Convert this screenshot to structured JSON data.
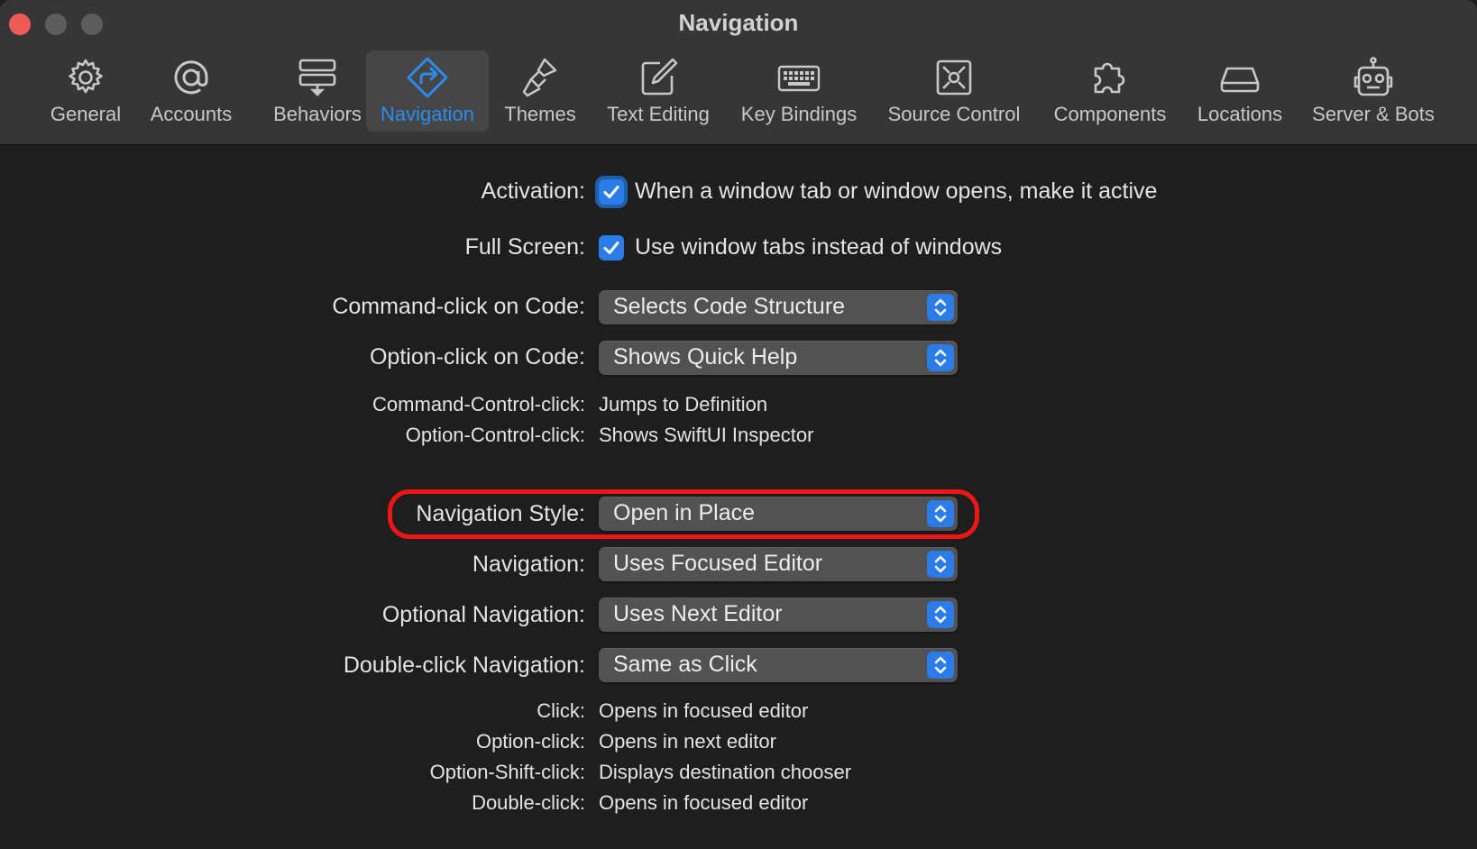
{
  "window": {
    "title": "Navigation"
  },
  "tabs": [
    {
      "label": "General",
      "icon": "gear-icon"
    },
    {
      "label": "Accounts",
      "icon": "at-sign-icon"
    },
    {
      "label": "Behaviors",
      "icon": "behaviors-icon"
    },
    {
      "label": "Navigation",
      "icon": "navigation-icon",
      "selected": true
    },
    {
      "label": "Themes",
      "icon": "brush-icon"
    },
    {
      "label": "Text Editing",
      "icon": "pencil-square-icon"
    },
    {
      "label": "Key Bindings",
      "icon": "keyboard-icon"
    },
    {
      "label": "Source Control",
      "icon": "source-control-icon"
    },
    {
      "label": "Components",
      "icon": "puzzle-icon"
    },
    {
      "label": "Locations",
      "icon": "drive-icon"
    },
    {
      "label": "Server & Bots",
      "icon": "robot-icon"
    }
  ],
  "activation": {
    "label": "Activation:",
    "checkbox_label": "When a window tab or window opens, make it active",
    "checked": true
  },
  "full_screen": {
    "label": "Full Screen:",
    "checkbox_label": "Use window tabs instead of windows",
    "checked": true
  },
  "command_click": {
    "label": "Command-click on Code:",
    "value": "Selects Code Structure"
  },
  "option_click": {
    "label": "Option-click on Code:",
    "value": "Shows Quick Help"
  },
  "command_control_click": {
    "label": "Command-Control-click:",
    "value": "Jumps to Definition"
  },
  "option_control_click": {
    "label": "Option-Control-click:",
    "value": "Shows SwiftUI Inspector"
  },
  "navigation_style": {
    "label": "Navigation Style:",
    "value": "Open in Place"
  },
  "navigation": {
    "label": "Navigation:",
    "value": "Uses Focused Editor"
  },
  "optional_navigation": {
    "label": "Optional Navigation:",
    "value": "Uses Next Editor"
  },
  "double_click_navigation": {
    "label": "Double-click Navigation:",
    "value": "Same as Click"
  },
  "summary": [
    {
      "label": "Click:",
      "value": "Opens in focused editor"
    },
    {
      "label": "Option-click:",
      "value": "Opens in next editor"
    },
    {
      "label": "Option-Shift-click:",
      "value": "Displays destination chooser"
    },
    {
      "label": "Double-click:",
      "value": "Opens in focused editor"
    }
  ],
  "colors": {
    "accent": "#2a7ce8",
    "highlight_ring": "#f01515",
    "close_button": "#ee5b55"
  }
}
